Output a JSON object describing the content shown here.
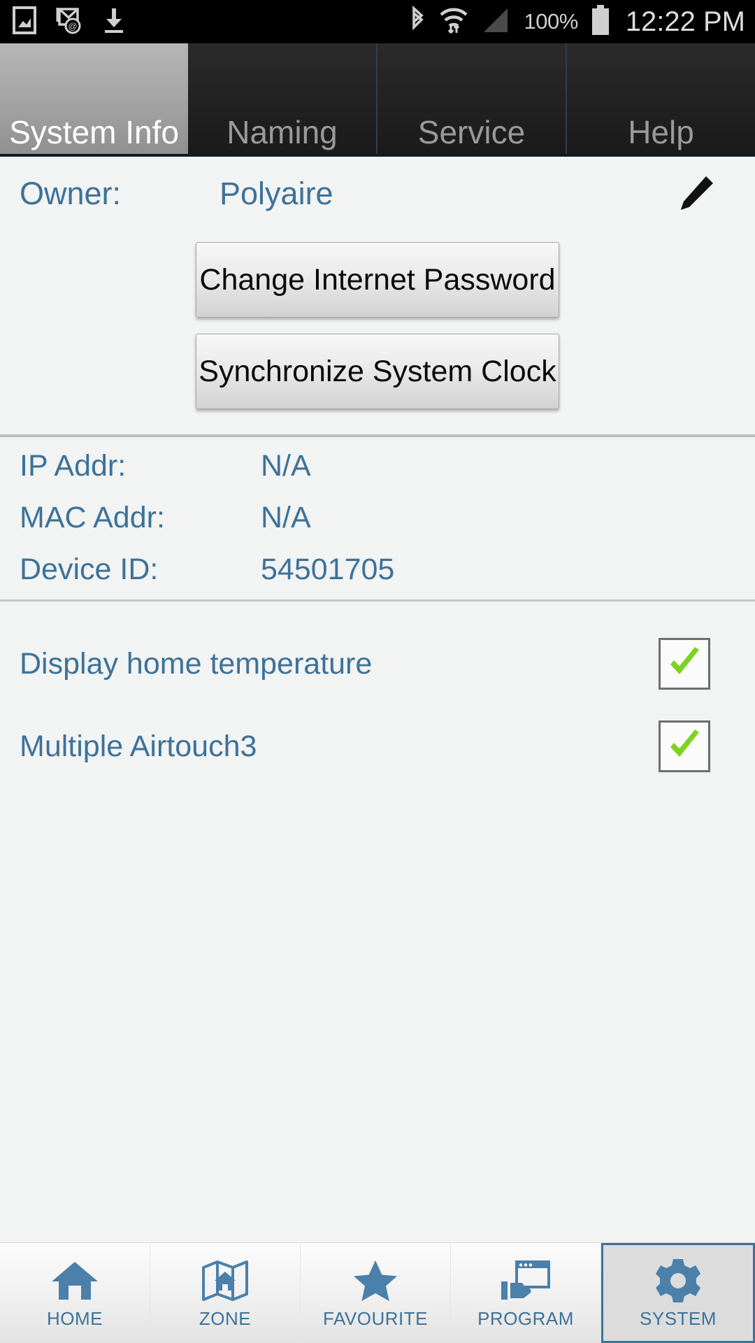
{
  "status_bar": {
    "icons_left": [
      "screenshot-icon",
      "email-at-icon",
      "download-icon"
    ],
    "icons_right": [
      "bluetooth-icon",
      "wifi-icon",
      "signal-icon"
    ],
    "battery_percent": "100%",
    "battery_icon": "battery-full-icon",
    "time": "12:22 PM"
  },
  "tabs": [
    {
      "label": "System Info",
      "active": true
    },
    {
      "label": "Naming",
      "active": false
    },
    {
      "label": "Service",
      "active": false
    },
    {
      "label": "Help",
      "active": false
    }
  ],
  "owner": {
    "label": "Owner:",
    "value": "Polyaire",
    "edit_icon": "pencil-icon"
  },
  "buttons": [
    {
      "label": "Change Internet Password"
    },
    {
      "label": "Synchronize System Clock"
    }
  ],
  "info_rows": [
    {
      "label": "IP Addr:",
      "value": "N/A"
    },
    {
      "label": "MAC Addr:",
      "value": "N/A"
    },
    {
      "label": "Device ID:",
      "value": "54501705"
    }
  ],
  "checkboxes": [
    {
      "label": "Display home temperature",
      "checked": true
    },
    {
      "label": "Multiple Airtouch3",
      "checked": true
    }
  ],
  "bottom_nav": [
    {
      "label": "HOME",
      "icon": "house-icon",
      "active": false
    },
    {
      "label": "ZONE",
      "icon": "map-house-icon",
      "active": false
    },
    {
      "label": "FAVOURITE",
      "icon": "star-icon",
      "active": false
    },
    {
      "label": "PROGRAM",
      "icon": "window-hand-icon",
      "active": false
    },
    {
      "label": "SYSTEM",
      "icon": "gear-icon",
      "active": true
    }
  ],
  "colors": {
    "accent_blue": "#3d7299",
    "check_green": "#7ed321",
    "status_bar_bg": "#000000",
    "page_bg": "#f2f3f3"
  }
}
